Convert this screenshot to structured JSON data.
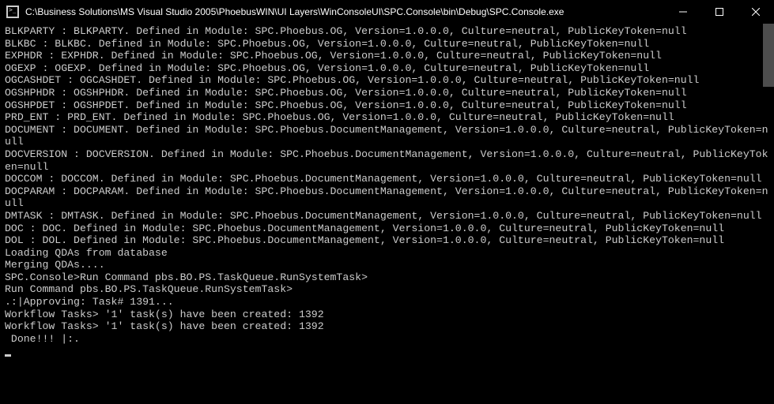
{
  "title": "C:\\Business Solutions\\MS Visual Studio 2005\\PhoebusWIN\\UI Layers\\WinConsoleUI\\SPC.Console\\bin\\Debug\\SPC.Console.exe",
  "lines": [
    "BLKPARTY : BLKPARTY. Defined in Module: SPC.Phoebus.OG, Version=1.0.0.0, Culture=neutral, PublicKeyToken=null",
    "BLKBC : BLKBC. Defined in Module: SPC.Phoebus.OG, Version=1.0.0.0, Culture=neutral, PublicKeyToken=null",
    "EXPHDR : EXPHDR. Defined in Module: SPC.Phoebus.OG, Version=1.0.0.0, Culture=neutral, PublicKeyToken=null",
    "OGEXP : OGEXP. Defined in Module: SPC.Phoebus.OG, Version=1.0.0.0, Culture=neutral, PublicKeyToken=null",
    "OGCASHDET : OGCASHDET. Defined in Module: SPC.Phoebus.OG, Version=1.0.0.0, Culture=neutral, PublicKeyToken=null",
    "OGSHPHDR : OGSHPHDR. Defined in Module: SPC.Phoebus.OG, Version=1.0.0.0, Culture=neutral, PublicKeyToken=null",
    "OGSHPDET : OGSHPDET. Defined in Module: SPC.Phoebus.OG, Version=1.0.0.0, Culture=neutral, PublicKeyToken=null",
    "PRD_ENT : PRD_ENT. Defined in Module: SPC.Phoebus.OG, Version=1.0.0.0, Culture=neutral, PublicKeyToken=null",
    "DOCUMENT : DOCUMENT. Defined in Module: SPC.Phoebus.DocumentManagement, Version=1.0.0.0, Culture=neutral, PublicKeyToken=null",
    "DOCVERSION : DOCVERSION. Defined in Module: SPC.Phoebus.DocumentManagement, Version=1.0.0.0, Culture=neutral, PublicKeyToken=null",
    "DOCCOM : DOCCOM. Defined in Module: SPC.Phoebus.DocumentManagement, Version=1.0.0.0, Culture=neutral, PublicKeyToken=null",
    "DOCPARAM : DOCPARAM. Defined in Module: SPC.Phoebus.DocumentManagement, Version=1.0.0.0, Culture=neutral, PublicKeyToken=null",
    "DMTASK : DMTASK. Defined in Module: SPC.Phoebus.DocumentManagement, Version=1.0.0.0, Culture=neutral, PublicKeyToken=null",
    "DOC : DOC. Defined in Module: SPC.Phoebus.DocumentManagement, Version=1.0.0.0, Culture=neutral, PublicKeyToken=null",
    "DOL : DOL. Defined in Module: SPC.Phoebus.DocumentManagement, Version=1.0.0.0, Culture=neutral, PublicKeyToken=null",
    "Loading QDAs from database",
    "Merging QDAs....",
    "SPC.Console>Run Command pbs.BO.PS.TaskQueue.RunSystemTask>",
    "Run Command pbs.BO.PS.TaskQueue.RunSystemTask>",
    ".:|Approving: Task# 1391...",
    "Workflow Tasks> '1' task(s) have been created: 1392",
    "Workflow Tasks> '1' task(s) have been created: 1392",
    " Done!!! |:."
  ]
}
